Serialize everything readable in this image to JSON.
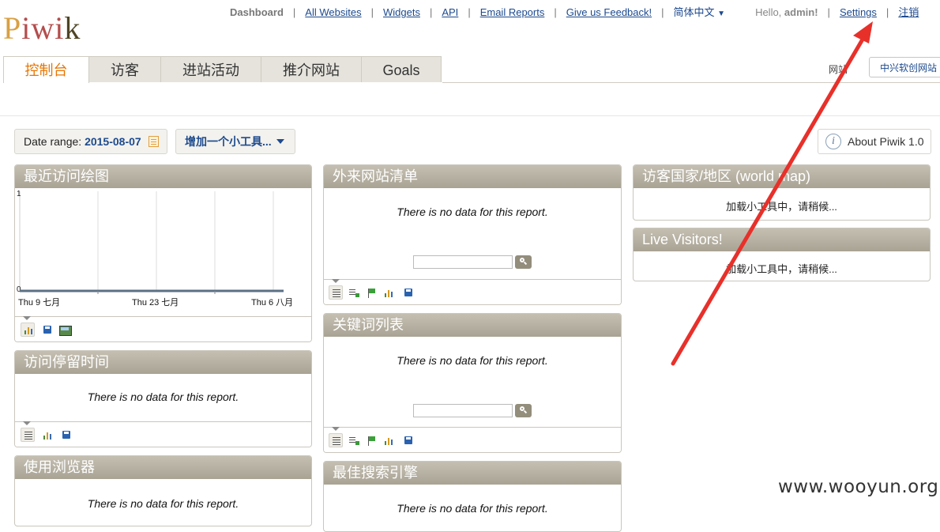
{
  "logo": {
    "letters": [
      "P",
      "i",
      "w",
      "i",
      "k"
    ],
    "colors": [
      "#d9a043",
      "#b54d4d",
      "#b54d4d",
      "#b54d4d",
      "#4f4424"
    ]
  },
  "topnav": {
    "dashboard": "Dashboard",
    "links": [
      "All Websites",
      "Widgets",
      "API",
      "Email Reports",
      "Give us Feedback!"
    ],
    "language": "简体中文",
    "hello_prefix": "Hello, ",
    "user": "admin!",
    "settings": "Settings",
    "logout": "注销"
  },
  "tabs": [
    "控制台",
    "访客",
    "进站活动",
    "推介网站",
    "Goals"
  ],
  "site": {
    "label": "网站",
    "selected": "中兴软创网站"
  },
  "daterange": {
    "label": "Date range: ",
    "value": "2015-08-07"
  },
  "add_widget": "增加一个小工具...",
  "about": "About Piwik 1.0",
  "no_data": "There is no data for this report.",
  "loading": "加载小工具中，请稍候...",
  "widgets": {
    "visits_graph": {
      "title": "最近访问绘图"
    },
    "visit_length": {
      "title": "访问停留时间"
    },
    "browsers": {
      "title": "使用浏览器"
    },
    "referrer_sites": {
      "title": "外来网站清单"
    },
    "keywords": {
      "title": "关键词列表"
    },
    "search_engines": {
      "title": "最佳搜索引擎"
    },
    "world_map": {
      "title": "访客国家/地区 (world map)"
    },
    "live": {
      "title": "Live Visitors!"
    }
  },
  "chart_data": {
    "type": "line",
    "x": [
      "Thu 9 七月",
      "Thu 23 七月",
      "Thu 6 八月"
    ],
    "series": [
      {
        "values": [
          0,
          0,
          0
        ]
      }
    ],
    "ylim": [
      0,
      1
    ],
    "yticks": [
      "1",
      "0"
    ]
  },
  "watermark": "www.wooyun.org",
  "colors": {
    "accent": "#e87500",
    "link": "#1d4a8e",
    "annotation_arrow": "#e8302a",
    "widget_header": "#b2ad9f"
  }
}
